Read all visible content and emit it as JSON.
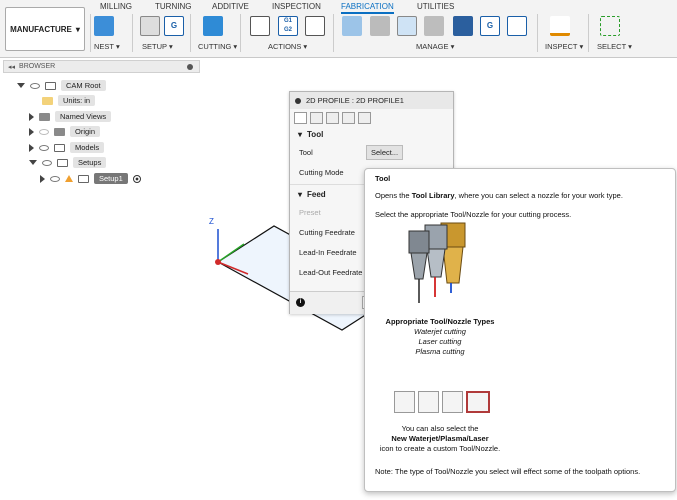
{
  "toolbar": {
    "workspace": "MANUFACTURE",
    "tabs": [
      "MILLING",
      "TURNING",
      "ADDITIVE",
      "INSPECTION",
      "FABRICATION",
      "UTILITIES"
    ],
    "active_tab": "FABRICATION",
    "groups": [
      "NEST",
      "SETUP",
      "CUTTING",
      "ACTIONS",
      "MANAGE",
      "INSPECT",
      "SELECT"
    ]
  },
  "browser": {
    "title": "BROWSER",
    "items": [
      "CAM Root",
      "Units: in",
      "Named Views",
      "Origin",
      "Models",
      "Setups",
      "Setup1"
    ]
  },
  "dialog": {
    "title": "2D PROFILE : 2D PROFILE1",
    "tool_section": "Tool",
    "tool_label": "Tool",
    "select_button": "Select...",
    "cutting_mode_label": "Cutting Mode",
    "feed_section": "Feed",
    "preset_label": "Preset",
    "cutting_feedrate": "Cutting Feedrate",
    "lead_in_feedrate": "Lead-In Feedrate",
    "lead_out_feedrate": "Lead-Out Feedrate",
    "info_icon": "info-icon"
  },
  "tooltip": {
    "title": "Tool",
    "line1_a": "Opens the ",
    "line1_b": "Tool Library",
    "line1_c": ", where you can select a nozzle for your work type.",
    "line2": "Select the appropriate Tool/Nozzle for your cutting process.",
    "types_heading": "Appropriate Tool/Nozzle Types",
    "types": [
      "Waterjet cutting",
      "Laser cutting",
      "Plasma cutting"
    ],
    "also_1": "You can also select the",
    "also_2": "New Waterjet/Plasma/Laser",
    "also_3": "icon to create a custom Tool/Nozzle.",
    "note": "Note: The type of Tool/Nozzle you select will effect some of the toolpath options."
  },
  "axes": {
    "z": "Z"
  },
  "colors": {
    "accent": "#0a6fc2",
    "badge": "#f0a030"
  }
}
